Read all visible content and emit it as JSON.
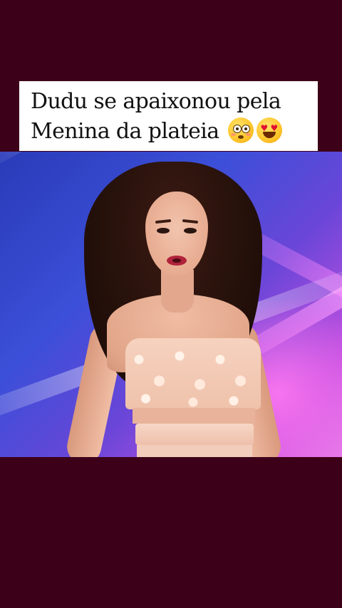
{
  "caption": {
    "line1": "Dudu se apaixonou pela",
    "line2": "Menina da plateia",
    "emojis": [
      "flushed-face-icon",
      "heart-eyes-face-icon"
    ]
  },
  "colors": {
    "background": "#3d0019",
    "caption_bg": "#ffffff",
    "caption_text": "#111111"
  }
}
